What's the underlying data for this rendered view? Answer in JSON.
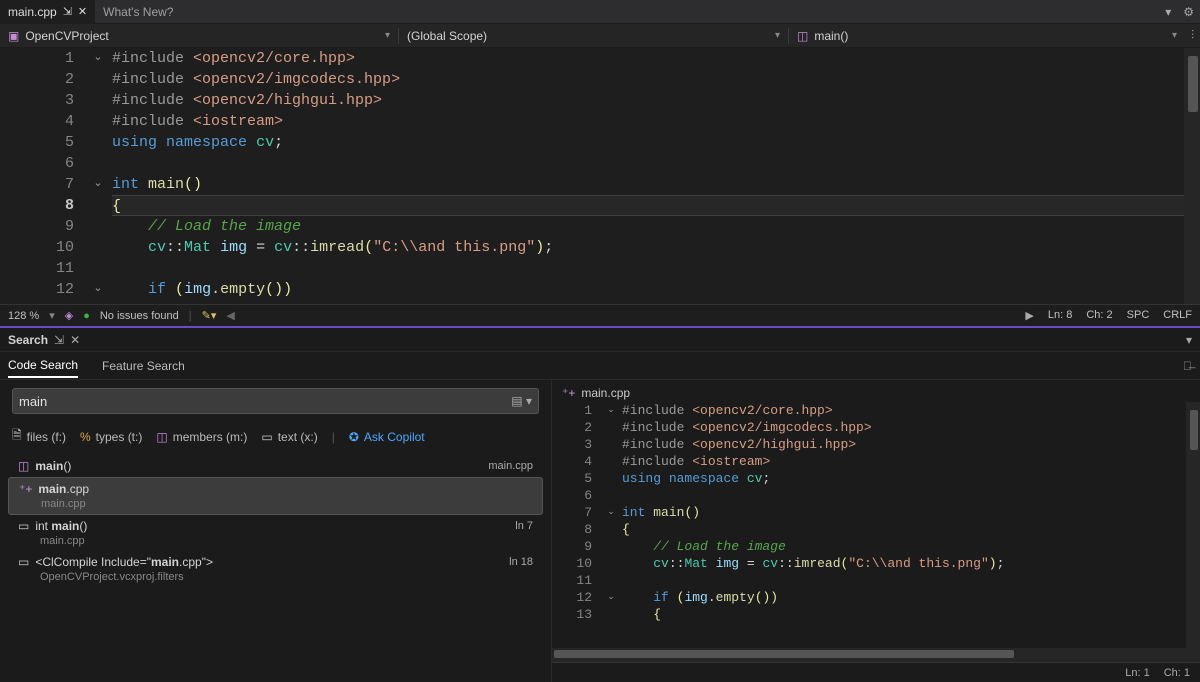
{
  "tabs": [
    {
      "label": "main.cpp",
      "pinned": true,
      "active": true
    },
    {
      "label": "What's New?",
      "pinned": false,
      "active": false
    }
  ],
  "scope": {
    "project": "OpenCVProject",
    "scope": "(Global Scope)",
    "member": "main()"
  },
  "editor": {
    "lines": [
      {
        "n": 1,
        "fold": "v",
        "html": "<span class='k-inc'>#include</span> <span class='k-str'>&lt;opencv2/core.hpp&gt;</span>"
      },
      {
        "n": 2,
        "fold": "",
        "html": "<span class='k-inc'>#include</span> <span class='k-str'>&lt;opencv2/imgcodecs.hpp&gt;</span>"
      },
      {
        "n": 3,
        "fold": "",
        "html": "<span class='k-inc'>#include</span> <span class='k-str'>&lt;opencv2/highgui.hpp&gt;</span>"
      },
      {
        "n": 4,
        "fold": "",
        "html": "<span class='k-inc'>#include</span> <span class='k-str'>&lt;iostream&gt;</span>"
      },
      {
        "n": 5,
        "fold": "",
        "html": "<span class='k-kw'>using</span> <span class='k-kw'>namespace</span> <span class='k-ty'>cv</span><span class='k-pn'>;</span>"
      },
      {
        "n": 6,
        "fold": "",
        "html": ""
      },
      {
        "n": 7,
        "fold": "v",
        "html": "<span class='k-kw'>int</span> <span class='k-fn'>main</span><span class='k-brace'>()</span>"
      },
      {
        "n": 8,
        "fold": "",
        "html": "<span class='k-brace'>{</span>",
        "current": true
      },
      {
        "n": 9,
        "fold": "",
        "html": "    <span class='k-cmt'>// Load the image</span>"
      },
      {
        "n": 10,
        "fold": "",
        "html": "    <span class='k-ty'>cv</span><span class='k-pn'>::</span><span class='k-ty'>Mat</span> <span class='k-var'>img</span> <span class='k-pn'>=</span> <span class='k-ty'>cv</span><span class='k-pn'>::</span><span class='k-fn'>imread</span><span class='k-brace'>(</span><span class='k-str'>\"C:\\\\and this.png\"</span><span class='k-brace'>)</span><span class='k-pn'>;</span>"
      },
      {
        "n": 11,
        "fold": "",
        "html": ""
      },
      {
        "n": 12,
        "fold": "v",
        "html": "    <span class='k-kw'>if</span> <span class='k-brace'>(</span><span class='k-var'>img</span><span class='k-pn'>.</span><span class='k-fn'>empty</span><span class='k-brace'>())</span>"
      }
    ]
  },
  "status": {
    "zoom": "128 %",
    "issues": "No issues found",
    "ln": "Ln: 8",
    "ch": "Ch: 2",
    "spc": "SPC",
    "crlf": "CRLF"
  },
  "search": {
    "title": "Search",
    "tabs": [
      "Code Search",
      "Feature Search"
    ],
    "active_tab": 0,
    "query": "main",
    "filters": {
      "files": "files (f:)",
      "types": "types (t:)",
      "members": "members (m:)",
      "text": "text (x:)",
      "copilot": "Ask Copilot"
    },
    "results": [
      {
        "icon": "cube",
        "label_html": "<b>main</b>()",
        "sub": "",
        "ln": "main.cpp",
        "selected": false
      },
      {
        "icon": "cpp",
        "label_html": "<b>main</b>.cpp",
        "sub": "main.cpp",
        "selected": true
      },
      {
        "icon": "abl",
        "label_html": "int <b>main</b>()",
        "sub": "main.cpp",
        "ln": "ln 7"
      },
      {
        "icon": "abl",
        "label_html": "&lt;ClCompile Include=\"<b>main</b>.cpp\"&gt;",
        "sub": "OpenCVProject.vcxproj.filters",
        "ln": "ln 18"
      }
    ],
    "preview": {
      "filename": "main.cpp",
      "lines": [
        {
          "n": 1,
          "fold": "v",
          "html": "<span class='k-inc'>#include</span> <span class='k-str'>&lt;opencv2/core.hpp&gt;</span>"
        },
        {
          "n": 2,
          "fold": "",
          "html": "<span class='k-inc'>#include</span> <span class='k-str'>&lt;opencv2/imgcodecs.hpp&gt;</span>"
        },
        {
          "n": 3,
          "fold": "",
          "html": "<span class='k-inc'>#include</span> <span class='k-str'>&lt;opencv2/highgui.hpp&gt;</span>"
        },
        {
          "n": 4,
          "fold": "",
          "html": "<span class='k-inc'>#include</span> <span class='k-str'>&lt;iostream&gt;</span>"
        },
        {
          "n": 5,
          "fold": "",
          "html": "<span class='k-kw'>using</span> <span class='k-kw'>namespace</span> <span class='k-ty'>cv</span><span class='k-pn'>;</span>"
        },
        {
          "n": 6,
          "fold": "",
          "html": ""
        },
        {
          "n": 7,
          "fold": "v",
          "html": "<span class='k-kw'>int</span> <span class='k-fn'>main</span><span class='k-brace'>()</span>"
        },
        {
          "n": 8,
          "fold": "",
          "html": "<span class='k-brace'>{</span>"
        },
        {
          "n": 9,
          "fold": "",
          "html": "    <span class='k-cmt'>// Load the image</span>"
        },
        {
          "n": 10,
          "fold": "",
          "html": "    <span class='k-ty'>cv</span><span class='k-pn'>::</span><span class='k-ty'>Mat</span> <span class='k-var'>img</span> <span class='k-pn'>=</span> <span class='k-ty'>cv</span><span class='k-pn'>::</span><span class='k-fn'>imread</span><span class='k-brace'>(</span><span class='k-str'>\"C:\\\\and this.png\"</span><span class='k-brace'>)</span><span class='k-pn'>;</span>"
        },
        {
          "n": 11,
          "fold": "",
          "html": ""
        },
        {
          "n": 12,
          "fold": "v",
          "html": "    <span class='k-kw'>if</span> <span class='k-brace'>(</span><span class='k-var'>img</span><span class='k-pn'>.</span><span class='k-fn'>empty</span><span class='k-brace'>())</span>"
        },
        {
          "n": 13,
          "fold": "",
          "html": "    <span class='k-brace'>{</span>"
        }
      ],
      "ln": "Ln: 1",
      "ch": "Ch: 1"
    }
  }
}
